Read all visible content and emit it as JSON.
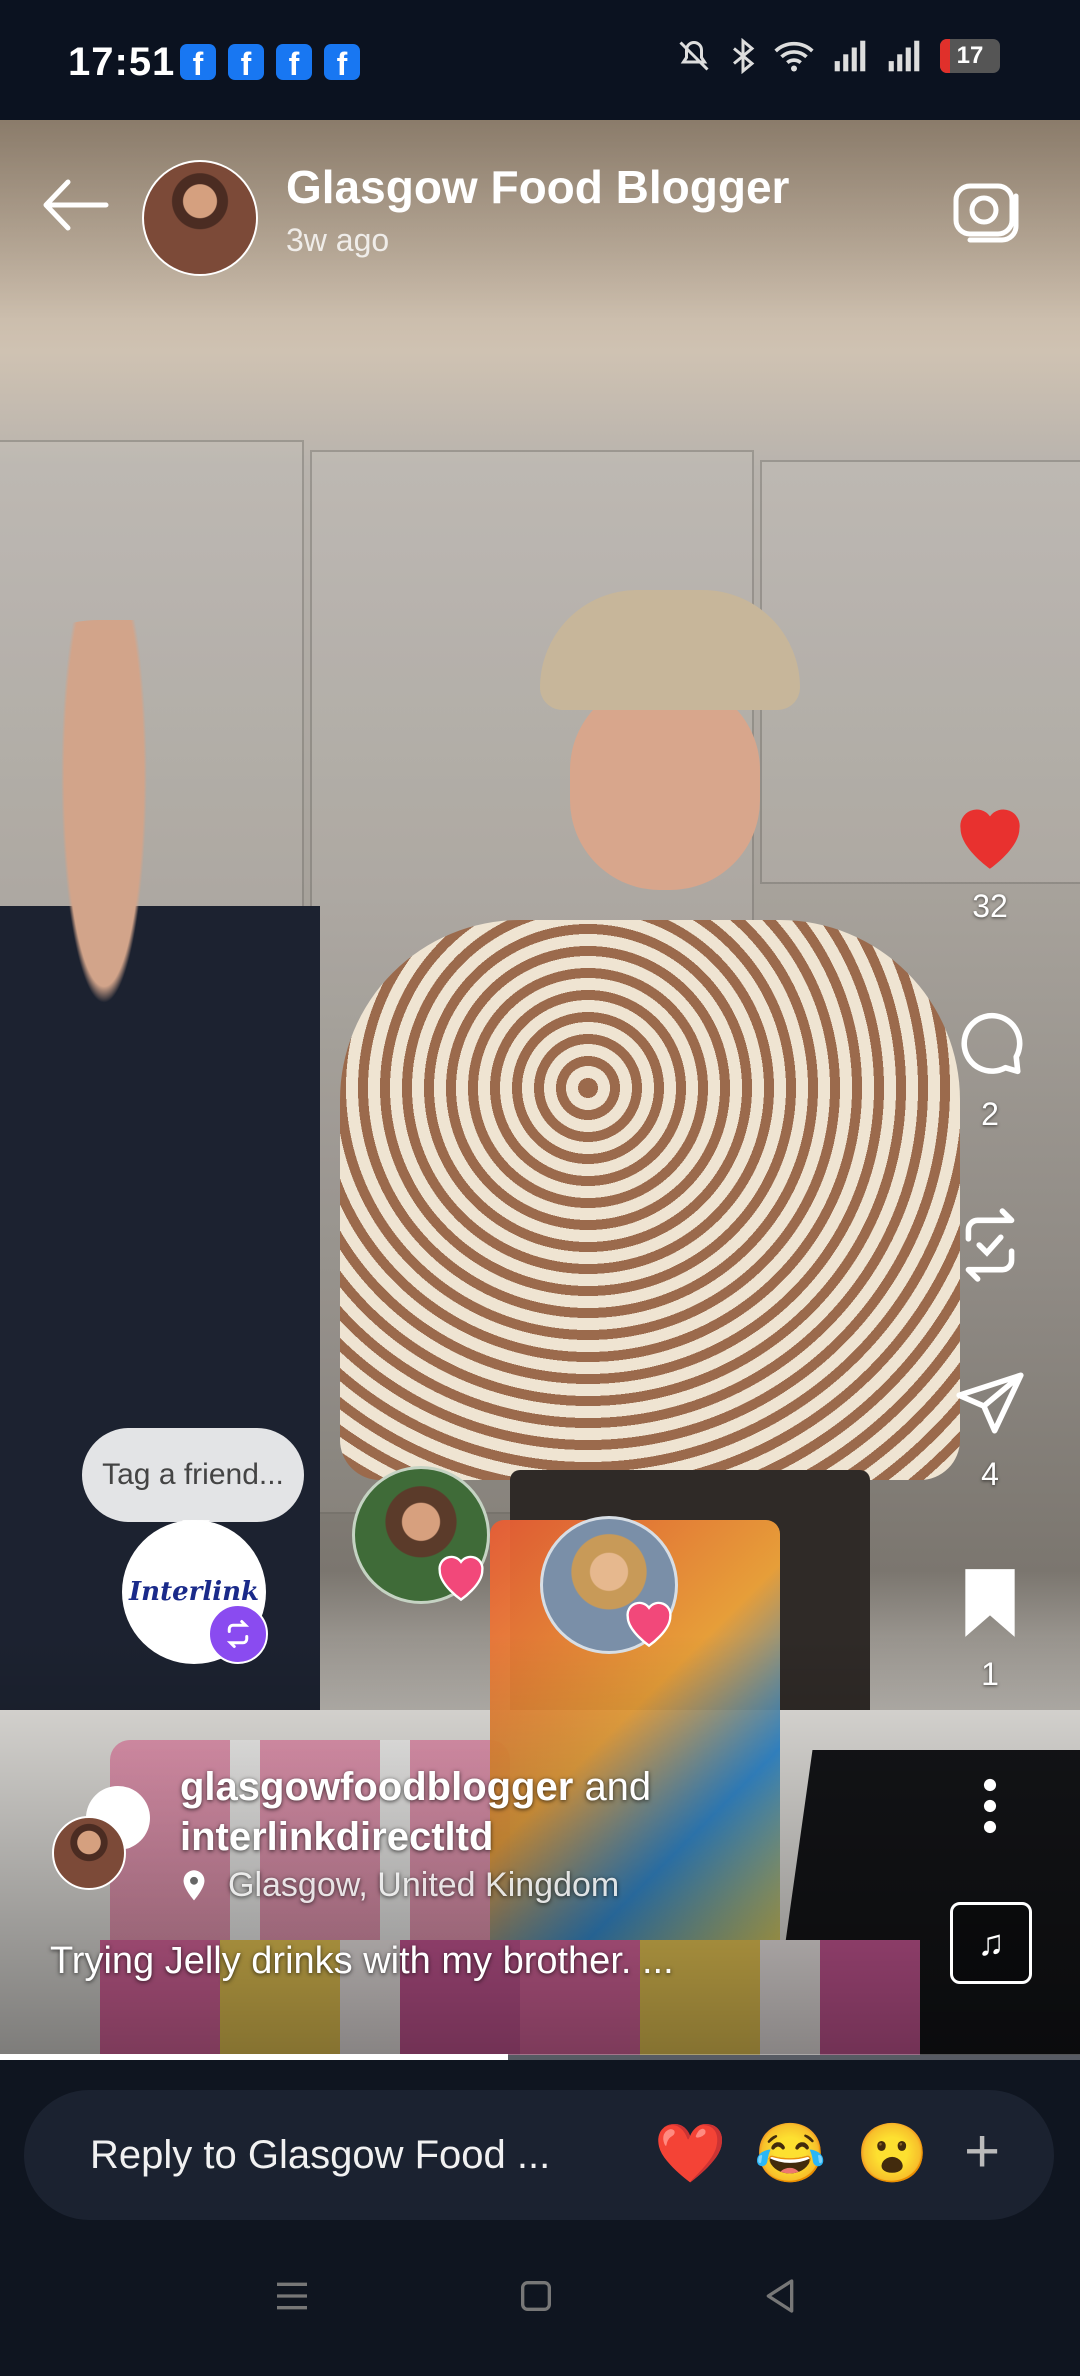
{
  "status_bar": {
    "time": "17:51",
    "notification_icons": [
      "facebook-icon",
      "facebook-icon",
      "facebook-icon",
      "facebook-icon"
    ],
    "battery_level": "17"
  },
  "header": {
    "name": "Glasgow Food Blogger",
    "posted": "3w ago"
  },
  "actions": {
    "likes": "32",
    "comments": "2",
    "reposts": "",
    "shares": "4",
    "saves": "1"
  },
  "tags": {
    "tag_prompt": "Tag a friend...",
    "logo_text": "Interlink"
  },
  "post": {
    "author": "glasgowfoodblogger",
    "joiner": "and",
    "collaborator": "interlinkdirectltd",
    "location": "Glasgow, United Kingdom",
    "caption": "Trying Jelly drinks with my brother. ..."
  },
  "progress": 0.47,
  "reply": {
    "placeholder": "Reply to Glasgow Food ...",
    "emojis": [
      "❤️",
      "😂",
      "😮"
    ]
  },
  "colors": {
    "like": "#e8312f",
    "accent": "#8a4bf0",
    "facebook": "#1877f2"
  }
}
